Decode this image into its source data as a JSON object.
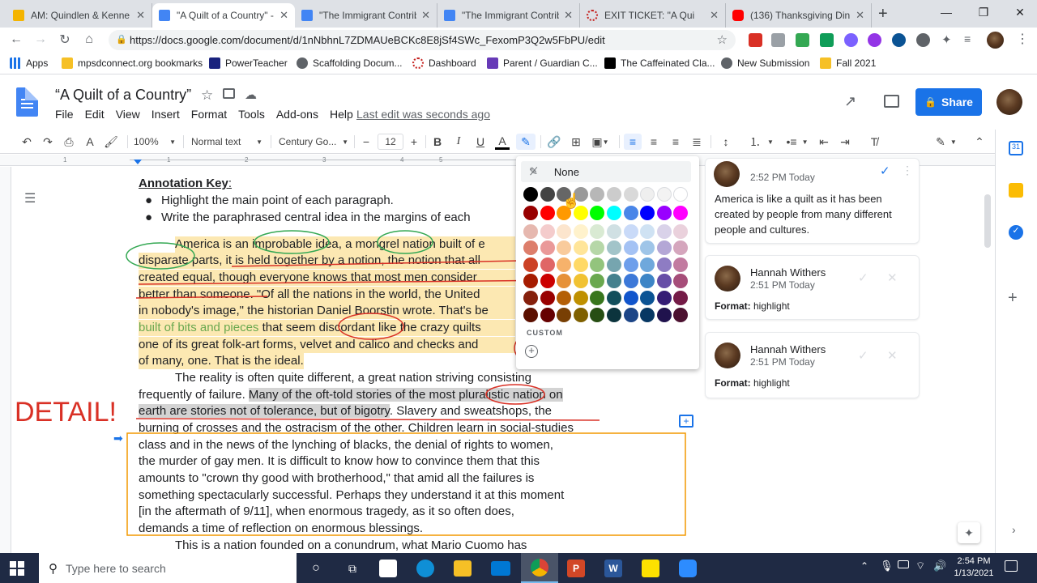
{
  "browser": {
    "tabs": [
      {
        "label": "AM: Quindlen & Kenne",
        "icon_color": "#f4b400"
      },
      {
        "label": "\"A Quilt of a Country\" -",
        "icon_color": "#4285f4"
      },
      {
        "label": "\"The Immigrant Contrib",
        "icon_color": "#4285f4"
      },
      {
        "label": "\"The Immigrant Contrib",
        "icon_color": "#4285f4"
      },
      {
        "label": "EXIT TICKET: \"A Qui",
        "icon_color": "#c5221f"
      },
      {
        "label": "(136) Thanksgiving Din",
        "icon_color": "#ff0000"
      }
    ],
    "url": "https://docs.google.com/document/d/1nNbhnL7ZDMAUeBCKc8E8jSf4SWc_FexomP3Q2w5FbPU/edit",
    "bookmarks": [
      {
        "label": "Apps",
        "icon": "apps-grid-icon"
      },
      {
        "label": "mpsdconnect.org bookmarks",
        "icon": "folder-icon"
      },
      {
        "label": "PowerTeacher",
        "icon": "powerteacher-icon"
      },
      {
        "label": "Scaffolding Docum...",
        "icon": "globe-icon"
      },
      {
        "label": "Dashboard",
        "icon": "dashboard-icon"
      },
      {
        "label": "Parent / Guardian C...",
        "icon": "parent-icon"
      },
      {
        "label": "The Caffeinated Cla...",
        "icon": "caffeinated-icon"
      },
      {
        "label": "New Submission",
        "icon": "globe-icon"
      },
      {
        "label": "Fall 2021",
        "icon": "folder-icon"
      }
    ]
  },
  "docs": {
    "title": "“A Quilt of a Country”",
    "menu": [
      "File",
      "Edit",
      "View",
      "Insert",
      "Format",
      "Tools",
      "Add-ons",
      "Help"
    ],
    "last_edit": "Last edit was seconds ago",
    "share_label": "Share",
    "toolbar": {
      "zoom": "100%",
      "style": "Normal text",
      "font": "Century Go...",
      "font_size": "12"
    }
  },
  "page": {
    "annotation_key": "Annotation Key",
    "annotation_colon": ":",
    "bullets": [
      "Highlight the main point of each paragraph.",
      "Write the paraphrased central idea in the margins of each"
    ],
    "p1": [
      "America is an improbable idea, a mongrel nation built of e",
      "disparate parts, it is held together by a notion, the notion that all",
      "created equal, though everyone knows that most men consider",
      "better than someone. \"Of all the nations in the world, the United",
      "in nobody's image,\" the historian Daniel Boorstin wrote. That's be",
      "built of bits and pieces",
      " that seem discordant like the crazy quilts",
      "one of its great folk-art forms, velvet and calico and checks and",
      "of many, one. That is the ideal."
    ],
    "p2": [
      "The reality is often quite different, a great nation striving consisting",
      "frequently of failure. ",
      "Many of the oft-told stories of the most pluralistic nation on",
      "earth are stories not of tolerance, but of bigotry",
      ". Slavery and sweatshops, the",
      "burning of crosses and the ostracism of the other. Children learn in social-studies",
      "class and in the news of the lynching of blacks, the denial of rights to women,",
      "the murder of gay men. It is difficult to know how to convince them that this",
      "amounts to \"crown thy good with brotherhood,\" that amid all the failures is",
      "something spectacularly successful. Perhaps they understand it at this moment",
      "[in the aftermath of 9/11], when enormous tragedy, as it so often does,",
      "demands a time of reflection on enormous blessings."
    ],
    "p3": "This is a nation founded on a conundrum, what Mario Cuomo has",
    "detail_label": "DETAIL!"
  },
  "palette": {
    "none_label": "None",
    "custom_label": "CUSTOM",
    "rows": [
      [
        "#000000",
        "#434343",
        "#666666",
        "#999999",
        "#b7b7b7",
        "#cccccc",
        "#d9d9d9",
        "#efefef",
        "#f3f3f3",
        "#ffffff"
      ],
      [
        "#980000",
        "#ff0000",
        "#ff9900",
        "#ffff00",
        "#00ff00",
        "#00ffff",
        "#4a86e8",
        "#0000ff",
        "#9900ff",
        "#ff00ff"
      ],
      [
        "#e6b8af",
        "#f4cccc",
        "#fce5cd",
        "#fff2cc",
        "#d9ead3",
        "#d0e0e3",
        "#c9daf8",
        "#cfe2f3",
        "#d9d2e9",
        "#ead1dc"
      ],
      [
        "#dd7e6b",
        "#ea9999",
        "#f9cb9c",
        "#ffe599",
        "#b6d7a8",
        "#a2c4c9",
        "#a4c2f4",
        "#9fc5e8",
        "#b4a7d6",
        "#d5a6bd"
      ],
      [
        "#cc4125",
        "#e06666",
        "#f6b26b",
        "#ffd966",
        "#93c47d",
        "#76a5af",
        "#6d9eeb",
        "#6fa8dc",
        "#8e7cc3",
        "#c27ba0"
      ],
      [
        "#a61c00",
        "#cc0000",
        "#e69138",
        "#f1c232",
        "#6aa84f",
        "#45818e",
        "#3c78d8",
        "#3d85c6",
        "#674ea7",
        "#a64d79"
      ],
      [
        "#85200c",
        "#990000",
        "#b45f06",
        "#bf9000",
        "#38761d",
        "#134f5c",
        "#1155cc",
        "#0b5394",
        "#351c75",
        "#741b47"
      ],
      [
        "#5b0f00",
        "#660000",
        "#783f04",
        "#7f6000",
        "#274e13",
        "#0c343d",
        "#1c4587",
        "#073763",
        "#20124d",
        "#4c1130"
      ]
    ]
  },
  "comments": [
    {
      "time": "2:52 PM Today",
      "body": "America is like a quilt as it has been created by people from many different people and cultures."
    },
    {
      "author": "Hannah Withers",
      "time": "2:51 PM Today",
      "format_label": "Format:",
      "format_value": " highlight"
    },
    {
      "author": "Hannah Withers",
      "time": "2:51 PM Today",
      "format_label": "Format:",
      "format_value": " highlight"
    }
  ],
  "taskbar": {
    "search_placeholder": "Type here to search",
    "time": "2:54 PM",
    "date": "1/13/2021"
  }
}
